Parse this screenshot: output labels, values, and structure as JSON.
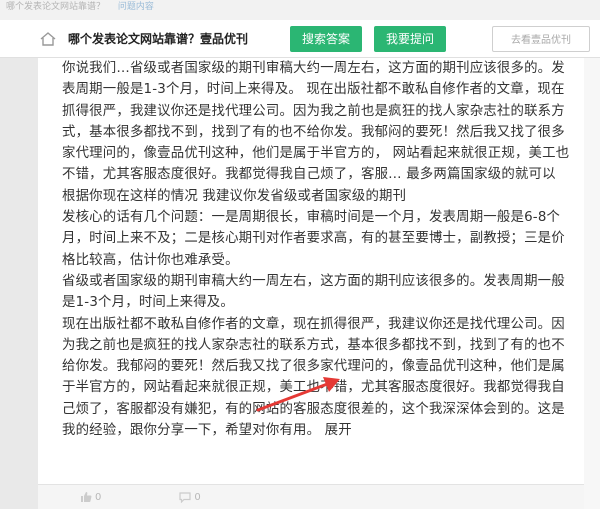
{
  "top_strip": {
    "text": "哪个发表论文网站靠谱？",
    "link": "问题内容"
  },
  "header": {
    "title": "哪个发表论文网站靠谱？壹品优刊",
    "search_answer": "搜索答案",
    "ask_question": "我要提问",
    "login": "去看壹品优刊"
  },
  "content": {
    "paragraphs": [
      "你说我们…省级或者国家级的期刊审稿大约一周左右，这方面的期刊应该很多的。发表周期一般是1-3个月，时间上来得及。 现在出版社都不敢私自修作者的文章，现在抓得很严，我建议你还是找代理公司。因为我之前也是疯狂的找人家杂志社的联系方式，基本很多都找不到，找到了有的也不给你发。我郁闷的要死！然后我又找了很多家代理问的，像壹品优刊这种，他们是属于半官方的， 网站看起来就很正规，美工也不错，尤其客服态度很好。我都觉得我自己烦了，客服… 最多两篇国家级的就可以",
      "根据你现在这样的情况 我建议你发省级或者国家级的期刊",
      "发核心的话有几个问题：一是周期很长，审稿时间是一个月，发表周期一般是6-8个月，时间上来不及；二是核心期刊对作者要求高，有的甚至要博士，副教授；三是价格比较高，估计你也难承受。",
      "省级或者国家级的期刊审稿大约一周左右，这方面的期刊应该很多的。发表周期一般是1-3个月，时间上来得及。",
      "现在出版社都不敢私自修作者的文章，现在抓得很严，我建议你还是找代理公司。因为我之前也是疯狂的找人家杂志社的联系方式，基本很多都找不到，找到了有的也不给你发。我郁闷的要死！然后我又找了很多家代理问的，像壹品优刊这种，他们是属于半官方的，网站看起来就很正规，美工也不错，尤其客服态度很好。我都觉得我自己烦了，客服都没有嫌犯，有的网站的客服态度很差的，这个我深深体会到的。这是我的经验，跟你分享一下，希望对你有用。 展开"
    ]
  },
  "footer": {
    "likes": "0",
    "comments": "0"
  },
  "colors": {
    "accent_green": "#2bb673",
    "arrow_red": "#e53935"
  }
}
